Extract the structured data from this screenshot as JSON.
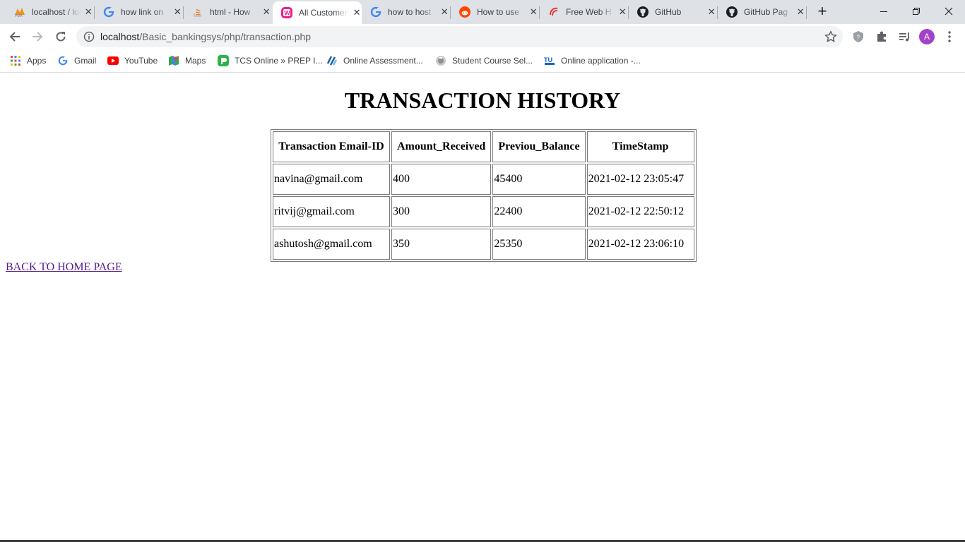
{
  "browser": {
    "tabs": [
      {
        "title": "localhost / localhost",
        "icon": "phpmyadmin-icon",
        "active": false
      },
      {
        "title": "how link on",
        "icon": "google-icon",
        "active": false
      },
      {
        "title": "html - How",
        "icon": "stackoverflow-icon",
        "active": false
      },
      {
        "title": "All Customers",
        "icon": "site-w-icon",
        "active": true
      },
      {
        "title": "how to host",
        "icon": "google-icon",
        "active": false
      },
      {
        "title": "How to use",
        "icon": "reddit-icon",
        "active": false
      },
      {
        "title": "Free Web H",
        "icon": "webhost-icon",
        "active": false
      },
      {
        "title": "GitHub",
        "icon": "github-icon",
        "active": false
      },
      {
        "title": "GitHub Pag",
        "icon": "github-icon",
        "active": false
      }
    ],
    "new_tab_symbol": "+",
    "url_host": "localhost",
    "url_path": "/Basic_bankingsys/php/transaction.php",
    "avatar_letter": "A",
    "bookmarks": [
      {
        "label": "Apps",
        "icon": "apps-grid-icon"
      },
      {
        "label": "Gmail",
        "icon": "google-icon"
      },
      {
        "label": "YouTube",
        "icon": "youtube-icon"
      },
      {
        "label": "Maps",
        "icon": "maps-icon"
      },
      {
        "label": "TCS Online » PREP I...",
        "icon": "tcs-icon"
      },
      {
        "label": "Online Assessment...",
        "icon": "assessment-icon"
      },
      {
        "label": "Student Course Sel...",
        "icon": "course-icon"
      },
      {
        "label": "Online application -...",
        "icon": "tu-icon"
      }
    ]
  },
  "page": {
    "heading": "TRANSACTION HISTORY",
    "columns": [
      "Transaction Email-ID",
      "Amount_Received",
      "Previou_Balance",
      "TimeStamp"
    ],
    "rows": [
      [
        "navina@gmail.com",
        "400",
        "45400",
        "2021-02-12 23:05:47"
      ],
      [
        "ritvij@gmail.com",
        "300",
        "22400",
        "2021-02-12 22:50:12"
      ],
      [
        "ashutosh@gmail.com",
        "350",
        "25350",
        "2021-02-12 23:06:10"
      ]
    ],
    "back_link": "BACK TO HOME PAGE"
  }
}
